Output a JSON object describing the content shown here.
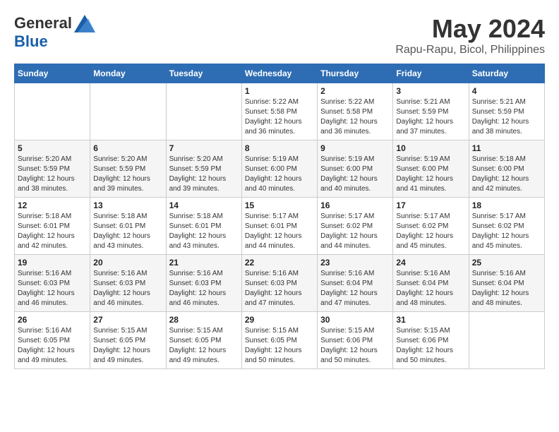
{
  "logo": {
    "general": "General",
    "blue": "Blue"
  },
  "title": {
    "month_year": "May 2024",
    "location": "Rapu-Rapu, Bicol, Philippines"
  },
  "weekdays": [
    "Sunday",
    "Monday",
    "Tuesday",
    "Wednesday",
    "Thursday",
    "Friday",
    "Saturday"
  ],
  "weeks": [
    [
      {
        "day": "",
        "info": ""
      },
      {
        "day": "",
        "info": ""
      },
      {
        "day": "",
        "info": ""
      },
      {
        "day": "1",
        "info": "Sunrise: 5:22 AM\nSunset: 5:58 PM\nDaylight: 12 hours\nand 36 minutes."
      },
      {
        "day": "2",
        "info": "Sunrise: 5:22 AM\nSunset: 5:58 PM\nDaylight: 12 hours\nand 36 minutes."
      },
      {
        "day": "3",
        "info": "Sunrise: 5:21 AM\nSunset: 5:59 PM\nDaylight: 12 hours\nand 37 minutes."
      },
      {
        "day": "4",
        "info": "Sunrise: 5:21 AM\nSunset: 5:59 PM\nDaylight: 12 hours\nand 38 minutes."
      }
    ],
    [
      {
        "day": "5",
        "info": "Sunrise: 5:20 AM\nSunset: 5:59 PM\nDaylight: 12 hours\nand 38 minutes."
      },
      {
        "day": "6",
        "info": "Sunrise: 5:20 AM\nSunset: 5:59 PM\nDaylight: 12 hours\nand 39 minutes."
      },
      {
        "day": "7",
        "info": "Sunrise: 5:20 AM\nSunset: 5:59 PM\nDaylight: 12 hours\nand 39 minutes."
      },
      {
        "day": "8",
        "info": "Sunrise: 5:19 AM\nSunset: 6:00 PM\nDaylight: 12 hours\nand 40 minutes."
      },
      {
        "day": "9",
        "info": "Sunrise: 5:19 AM\nSunset: 6:00 PM\nDaylight: 12 hours\nand 40 minutes."
      },
      {
        "day": "10",
        "info": "Sunrise: 5:19 AM\nSunset: 6:00 PM\nDaylight: 12 hours\nand 41 minutes."
      },
      {
        "day": "11",
        "info": "Sunrise: 5:18 AM\nSunset: 6:00 PM\nDaylight: 12 hours\nand 42 minutes."
      }
    ],
    [
      {
        "day": "12",
        "info": "Sunrise: 5:18 AM\nSunset: 6:01 PM\nDaylight: 12 hours\nand 42 minutes."
      },
      {
        "day": "13",
        "info": "Sunrise: 5:18 AM\nSunset: 6:01 PM\nDaylight: 12 hours\nand 43 minutes."
      },
      {
        "day": "14",
        "info": "Sunrise: 5:18 AM\nSunset: 6:01 PM\nDaylight: 12 hours\nand 43 minutes."
      },
      {
        "day": "15",
        "info": "Sunrise: 5:17 AM\nSunset: 6:01 PM\nDaylight: 12 hours\nand 44 minutes."
      },
      {
        "day": "16",
        "info": "Sunrise: 5:17 AM\nSunset: 6:02 PM\nDaylight: 12 hours\nand 44 minutes."
      },
      {
        "day": "17",
        "info": "Sunrise: 5:17 AM\nSunset: 6:02 PM\nDaylight: 12 hours\nand 45 minutes."
      },
      {
        "day": "18",
        "info": "Sunrise: 5:17 AM\nSunset: 6:02 PM\nDaylight: 12 hours\nand 45 minutes."
      }
    ],
    [
      {
        "day": "19",
        "info": "Sunrise: 5:16 AM\nSunset: 6:03 PM\nDaylight: 12 hours\nand 46 minutes."
      },
      {
        "day": "20",
        "info": "Sunrise: 5:16 AM\nSunset: 6:03 PM\nDaylight: 12 hours\nand 46 minutes."
      },
      {
        "day": "21",
        "info": "Sunrise: 5:16 AM\nSunset: 6:03 PM\nDaylight: 12 hours\nand 46 minutes."
      },
      {
        "day": "22",
        "info": "Sunrise: 5:16 AM\nSunset: 6:03 PM\nDaylight: 12 hours\nand 47 minutes."
      },
      {
        "day": "23",
        "info": "Sunrise: 5:16 AM\nSunset: 6:04 PM\nDaylight: 12 hours\nand 47 minutes."
      },
      {
        "day": "24",
        "info": "Sunrise: 5:16 AM\nSunset: 6:04 PM\nDaylight: 12 hours\nand 48 minutes."
      },
      {
        "day": "25",
        "info": "Sunrise: 5:16 AM\nSunset: 6:04 PM\nDaylight: 12 hours\nand 48 minutes."
      }
    ],
    [
      {
        "day": "26",
        "info": "Sunrise: 5:16 AM\nSunset: 6:05 PM\nDaylight: 12 hours\nand 49 minutes."
      },
      {
        "day": "27",
        "info": "Sunrise: 5:15 AM\nSunset: 6:05 PM\nDaylight: 12 hours\nand 49 minutes."
      },
      {
        "day": "28",
        "info": "Sunrise: 5:15 AM\nSunset: 6:05 PM\nDaylight: 12 hours\nand 49 minutes."
      },
      {
        "day": "29",
        "info": "Sunrise: 5:15 AM\nSunset: 6:05 PM\nDaylight: 12 hours\nand 50 minutes."
      },
      {
        "day": "30",
        "info": "Sunrise: 5:15 AM\nSunset: 6:06 PM\nDaylight: 12 hours\nand 50 minutes."
      },
      {
        "day": "31",
        "info": "Sunrise: 5:15 AM\nSunset: 6:06 PM\nDaylight: 12 hours\nand 50 minutes."
      },
      {
        "day": "",
        "info": ""
      }
    ]
  ]
}
